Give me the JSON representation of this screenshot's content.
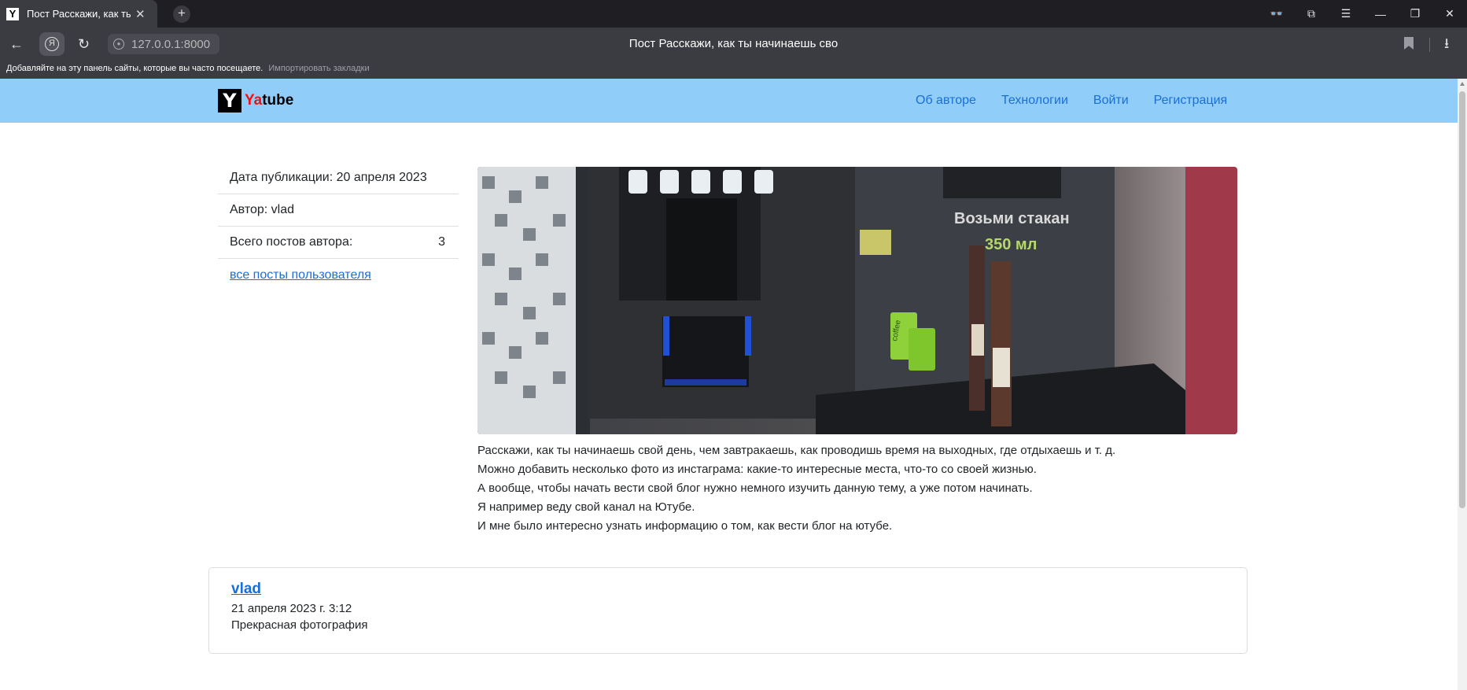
{
  "browser": {
    "tab_title": "Пост Расскажи, как ты",
    "tab_favicon": "Y",
    "page_title": "Пост Расскажи, как ты начинаешь сво",
    "url": "127.0.0.1:8000",
    "bookmarks_hint": "Добавляйте на эту панель сайты, которые вы часто посещаете.",
    "bookmarks_import": "Импортировать закладки",
    "icons": [
      "back-icon",
      "yandex-icon",
      "reload-icon",
      "lock-icon",
      "bookmark-icon",
      "download-icon",
      "glasses-icon",
      "collections-icon",
      "menu-icon",
      "minimize-icon",
      "restore-icon",
      "close-icon"
    ]
  },
  "site": {
    "logo_letter": "Y",
    "brand_prefix": "Ya",
    "brand_suffix": "tube",
    "nav": {
      "about": "Об авторе",
      "tech": "Технологии",
      "login": "Войти",
      "signup": "Регистрация"
    },
    "colors": {
      "navbar": "#90cdf8",
      "link": "#1a6ed8"
    }
  },
  "post": {
    "pub_date": "Дата публикации: 20 апреля 2023",
    "author": "Автор: vlad",
    "posts_count_label": "Всего постов автора:",
    "posts_count": "3",
    "all_posts_link": "все посты пользователя",
    "image_overlay_line1": "Возьми стакан",
    "image_overlay_line2": "350 мл",
    "image_cup_label": "coffee",
    "text": [
      "Расскажи, как ты начинаешь свой день, чем завтракаешь, как проводишь время на выходных, где отдыхаешь и т. д.",
      "Можно добавить несколько фото из инстаграма: какие-то интересные места, что-то со своей жизнью.",
      "А вообще, чтобы начать вести свой блог нужно немного изучить данную тему, а уже потом начинать.",
      "Я например веду свой канал на Ютубе.",
      "И мне было интересно узнать информацию о том, как вести блог на ютубе."
    ]
  },
  "comment": {
    "author": "vlad",
    "date": "21 апреля 2023 г. 3:12",
    "text": "Прекрасная фотография"
  }
}
